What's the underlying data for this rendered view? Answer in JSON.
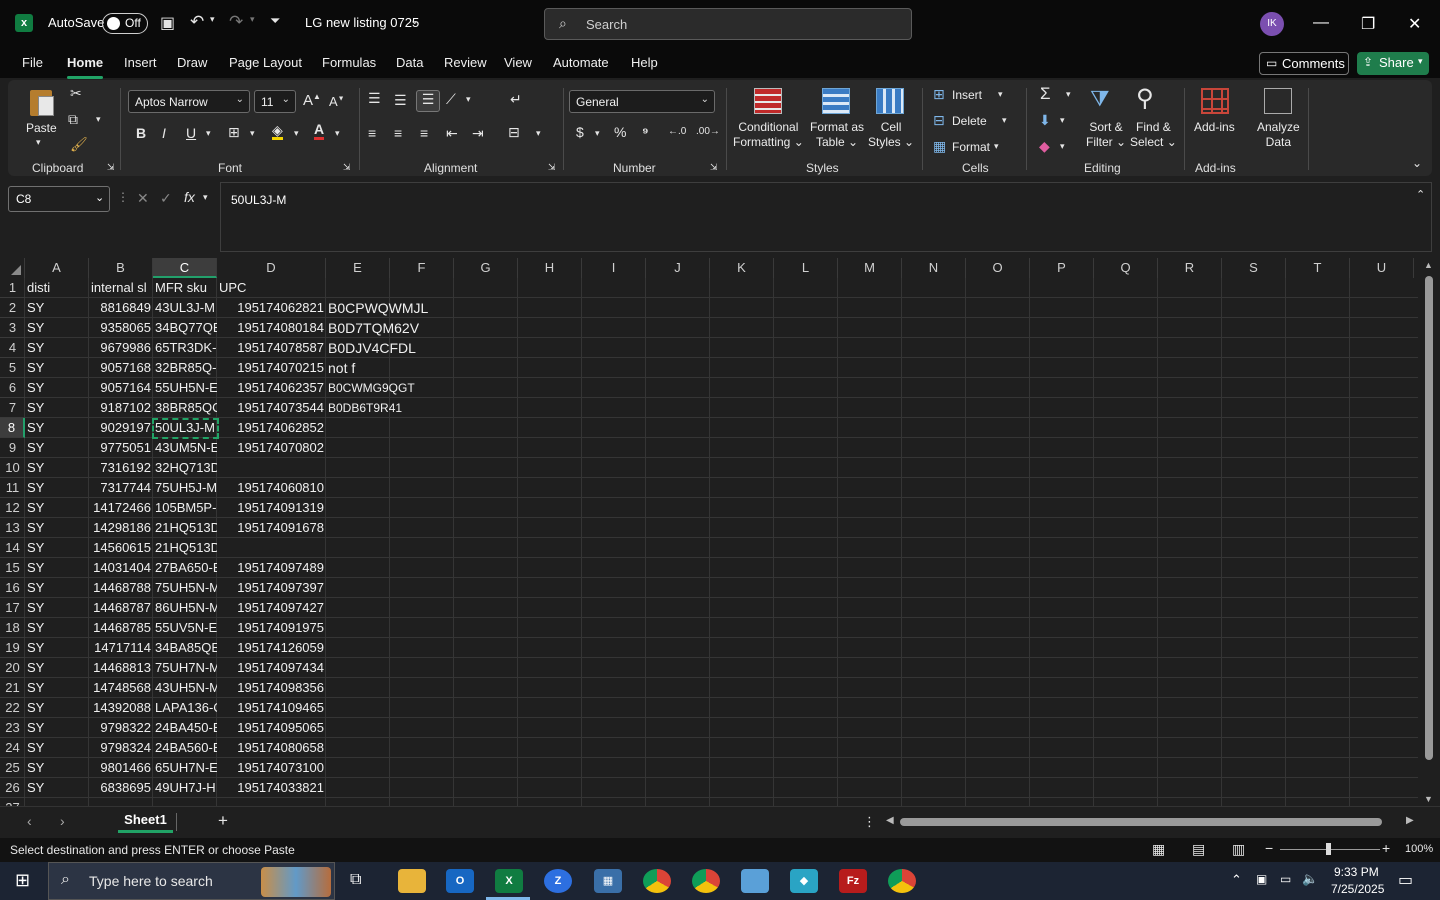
{
  "titlebar": {
    "autosave_label": "AutoSave",
    "autosave_state": "Off",
    "file_name": "LG new listing 0725",
    "search_placeholder": "Search",
    "avatar_initials": "IK"
  },
  "menu": [
    "File",
    "Home",
    "Insert",
    "Draw",
    "Page Layout",
    "Formulas",
    "Data",
    "Review",
    "View",
    "Automate",
    "Help"
  ],
  "menu_active": "Home",
  "actions": {
    "comments": "Comments",
    "share": "Share"
  },
  "ribbon": {
    "clipboard": {
      "label": "Clipboard",
      "paste": "Paste"
    },
    "font": {
      "label": "Font",
      "family": "Aptos Narrow",
      "size": "11"
    },
    "alignment": {
      "label": "Alignment"
    },
    "number": {
      "label": "Number",
      "format": "General"
    },
    "styles": {
      "label": "Styles",
      "cond1": "Conditional",
      "cond2": "Formatting",
      "fmt1": "Format as",
      "fmt2": "Table",
      "cell1": "Cell",
      "cell2": "Styles"
    },
    "cells": {
      "label": "Cells",
      "insert": "Insert",
      "delete": "Delete",
      "format": "Format"
    },
    "editing": {
      "label": "Editing",
      "sort1": "Sort &",
      "sort2": "Filter",
      "find1": "Find &",
      "find2": "Select"
    },
    "addins": {
      "label": "Add-ins",
      "addins": "Add-ins",
      "analyze1": "Analyze",
      "analyze2": "Data"
    }
  },
  "formula_bar": {
    "name_box": "C8",
    "formula": "50UL3J-M"
  },
  "columns": [
    "A",
    "B",
    "C",
    "D",
    "E",
    "F",
    "G",
    "H",
    "I",
    "J",
    "K",
    "L",
    "M",
    "N",
    "O",
    "P",
    "Q",
    "R",
    "S",
    "T",
    "U"
  ],
  "rows": [
    [
      "disti",
      "internal sl",
      "MFR sku",
      "UPC",
      ""
    ],
    [
      "SY",
      "8816849",
      "43UL3J-M",
      "195174062821",
      "B0CPWQWMJL"
    ],
    [
      "SY",
      "9358065",
      "34BQ77QE",
      "195174080184",
      "B0D7TQM62V"
    ],
    [
      "SY",
      "9679986",
      "65TR3DK-E",
      "195174078587",
      "B0DJV4CFDL"
    ],
    [
      "SY",
      "9057168",
      "32BR85Q-I",
      "195174070215",
      "not f"
    ],
    [
      "SY",
      "9057164",
      "55UH5N-E",
      "195174062357",
      "B0CWMG9QGT"
    ],
    [
      "SY",
      "9187102",
      "38BR85QC",
      "195174073544",
      "B0DB6T9R41"
    ],
    [
      "SY",
      "9029197",
      "50UL3J-M",
      "195174062852",
      ""
    ],
    [
      "SY",
      "9775051",
      "43UM5N-E",
      "195174070802",
      ""
    ],
    [
      "SY",
      "7316192",
      "32HQ713D",
      "",
      ""
    ],
    [
      "SY",
      "7317744",
      "75UH5J-M",
      "195174060810",
      ""
    ],
    [
      "SY",
      "14172466",
      "105BM5P-",
      "195174091319",
      ""
    ],
    [
      "SY",
      "14298186",
      "21HQ513D",
      "195174091678",
      ""
    ],
    [
      "SY",
      "14560615",
      "21HQ513D",
      "",
      ""
    ],
    [
      "SY",
      "14031404",
      "27BA650-E",
      "195174097489",
      ""
    ],
    [
      "SY",
      "14468788",
      "75UH5N-M",
      "195174097397",
      ""
    ],
    [
      "SY",
      "14468787",
      "86UH5N-M",
      "195174097427",
      ""
    ],
    [
      "SY",
      "14468785",
      "55UV5N-E",
      "195174091975",
      ""
    ],
    [
      "SY",
      "14717114",
      "34BA85QE",
      "195174126059",
      ""
    ],
    [
      "SY",
      "14468813",
      "75UH7N-M",
      "195174097434",
      ""
    ],
    [
      "SY",
      "14748568",
      "43UH5N-M",
      "195174098356",
      ""
    ],
    [
      "SY",
      "14392088",
      "LAPA136-C",
      "195174109465",
      ""
    ],
    [
      "SY",
      "9798322",
      "24BA450-E",
      "195174095065",
      ""
    ],
    [
      "SY",
      "9798324",
      "24BA560-E",
      "195174080658",
      ""
    ],
    [
      "SY",
      "9801466",
      "65UH7N-E",
      "195174073100",
      ""
    ],
    [
      "SY",
      "6838695",
      "49UH7J-H",
      "195174033821",
      ""
    ]
  ],
  "sheet": {
    "name": "Sheet1",
    "add": "+"
  },
  "status": {
    "message": "Select destination and press ENTER or choose Paste",
    "zoom": "100%"
  },
  "taskbar": {
    "search_placeholder": "Type here to search",
    "time": "9:33 PM",
    "date": "7/25/2025"
  },
  "colors": {
    "accent": "#21a366",
    "share": "#1f7d4c"
  }
}
